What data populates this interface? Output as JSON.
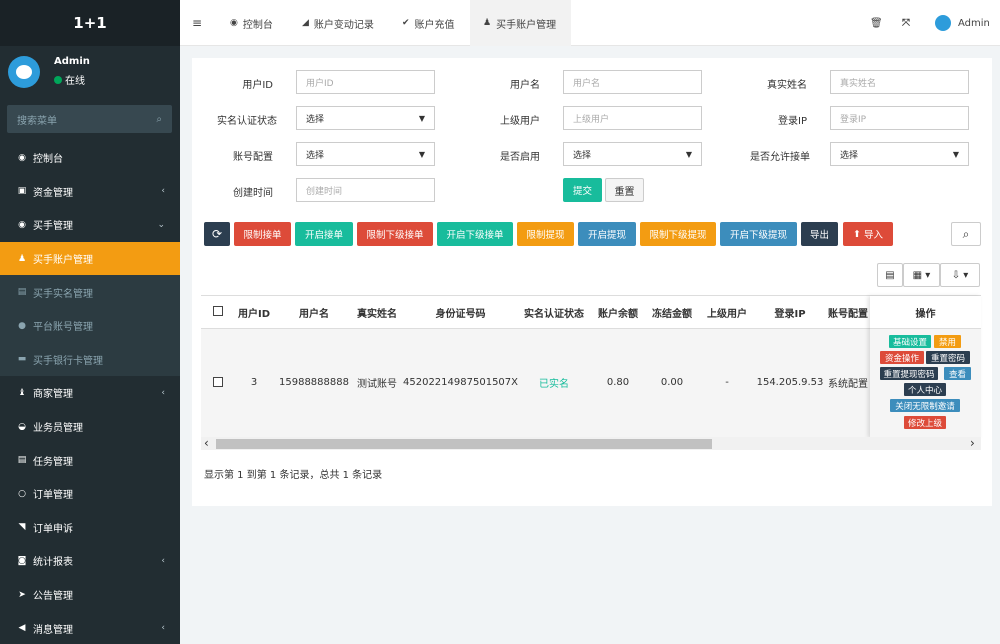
{
  "app": {
    "title": "1+1"
  },
  "user": {
    "name": "Admin",
    "status": "在线"
  },
  "search": {
    "placeholder": "搜索菜单"
  },
  "menu": [
    {
      "label": "控制台",
      "icon": "dashboard-icon",
      "icon_glyph": "◉"
    },
    {
      "label": "资金管理",
      "icon": "money-icon",
      "icon_glyph": "▣",
      "arrow": "‹"
    },
    {
      "label": "买手管理",
      "icon": "user-circle-icon",
      "icon_glyph": "◉",
      "arrow": "⌄"
    },
    {
      "label": "买手账户管理",
      "icon": "user-icon",
      "icon_glyph": "♟",
      "active": true
    },
    {
      "label": "买手实名管理",
      "icon": "id-card-icon",
      "icon_glyph": "▤",
      "sub": true
    },
    {
      "label": "平台账号管理",
      "icon": "circle-icon",
      "icon_glyph": "●",
      "sub": true
    },
    {
      "label": "买手银行卡管理",
      "icon": "credit-card-icon",
      "icon_glyph": "▬",
      "sub": true
    },
    {
      "label": "商家管理",
      "icon": "shop-icon",
      "icon_glyph": "♝",
      "arrow": "‹"
    },
    {
      "label": "业务员管理",
      "icon": "agent-icon",
      "icon_glyph": "◒"
    },
    {
      "label": "任务管理",
      "icon": "list-icon",
      "icon_glyph": "▤"
    },
    {
      "label": "订单管理",
      "icon": "order-circle-icon",
      "icon_glyph": "○"
    },
    {
      "label": "订单申诉",
      "icon": "appeal-icon",
      "icon_glyph": "◥"
    },
    {
      "label": "统计报表",
      "icon": "database-icon",
      "icon_glyph": "◙",
      "arrow": "‹"
    },
    {
      "label": "公告管理",
      "icon": "paper-plane-icon",
      "icon_glyph": "➤"
    },
    {
      "label": "消息管理",
      "icon": "bullhorn-icon",
      "icon_glyph": "◀",
      "arrow": "‹"
    }
  ],
  "topbar": {
    "menu_toggle": "≡",
    "tabs": [
      {
        "label": "控制台",
        "icon_glyph": "◉"
      },
      {
        "label": "账户变动记录",
        "icon_glyph": "◢"
      },
      {
        "label": "账户充值",
        "icon_glyph": "✔"
      },
      {
        "label": "买手账户管理",
        "icon_glyph": "♟"
      }
    ],
    "right_user": "Admin"
  },
  "filters": {
    "user_id": {
      "label": "用户ID",
      "placeholder": "用户ID"
    },
    "username": {
      "label": "用户名",
      "placeholder": "用户名"
    },
    "realname": {
      "label": "真实姓名",
      "placeholder": "真实姓名"
    },
    "verify_status": {
      "label": "实名认证状态",
      "value": "选择"
    },
    "parent_user": {
      "label": "上级用户",
      "placeholder": "上级用户"
    },
    "login_ip": {
      "label": "登录IP",
      "placeholder": "登录IP"
    },
    "account_config": {
      "label": "账号配置",
      "value": "选择"
    },
    "enabled": {
      "label": "是否启用",
      "value": "选择"
    },
    "allow_order": {
      "label": "是否允许接单",
      "value": "选择"
    },
    "created_time": {
      "label": "创建时间",
      "placeholder": "创建时间"
    },
    "submit": "提交",
    "reset": "重置"
  },
  "toolbar": {
    "refresh_icon": "⟳",
    "buttons": [
      {
        "label": "限制接单",
        "color": "#dd4b39"
      },
      {
        "label": "开启接单",
        "color": "#18bc9c"
      },
      {
        "label": "限制下级接单",
        "color": "#dd4b39"
      },
      {
        "label": "开启下级接单",
        "color": "#18bc9c"
      },
      {
        "label": "限制提现",
        "color": "#f39c12"
      },
      {
        "label": "开启提现",
        "color": "#3c8dbc"
      },
      {
        "label": "限制下级提现",
        "color": "#f39c12"
      },
      {
        "label": "开启下级提现",
        "color": "#3c8dbc"
      },
      {
        "label": "导出",
        "color": "#2c3e50"
      },
      {
        "label": "导入",
        "color": "#dd4b39"
      }
    ],
    "search_icon": "⌕",
    "right_buttons": [
      "▤",
      "▦ ▾",
      "⇩ ▾"
    ]
  },
  "table": {
    "headers": [
      "用户ID",
      "用户名",
      "真实姓名",
      "身份证号码",
      "实名认证状态",
      "账户余额",
      "冻结金额",
      "上级用户",
      "登录IP",
      "账号配置",
      "操作"
    ],
    "row": {
      "user_id": "3",
      "username": "15988888888",
      "realname": "测试账号",
      "id_number": "45202214987501507X",
      "verify_status": "已实名",
      "balance": "0.80",
      "frozen": "0.00",
      "parent": "-",
      "login_ip": "154.205.9.53",
      "account_config": "系统配置"
    },
    "actions": [
      {
        "label": "基础设置",
        "color": "#18bc9c"
      },
      {
        "label": "禁用",
        "color": "#f39c12"
      },
      {
        "label": "资金操作",
        "color": "#dd4b39"
      },
      {
        "label": "重置密码",
        "color": "#2c3e50"
      },
      {
        "label": "重置提现密码",
        "color": "#2c3e50"
      },
      {
        "label": "查看",
        "color": "#3c8dbc"
      },
      {
        "label": "个人中心",
        "color": "#2c3e50"
      },
      {
        "label": "关闭无限制邀请",
        "color": "#3c8dbc"
      },
      {
        "label": "修改上级",
        "color": "#dd4b39"
      }
    ],
    "scroll_left": "‹",
    "scroll_right": "›"
  },
  "pagination": {
    "summary": "显示第 1 到第 1 条记录，总共 1 条记录"
  },
  "colors": {
    "sidebar": "#222d32",
    "accent": "#f39c12",
    "success_text": "#18bc9c"
  }
}
